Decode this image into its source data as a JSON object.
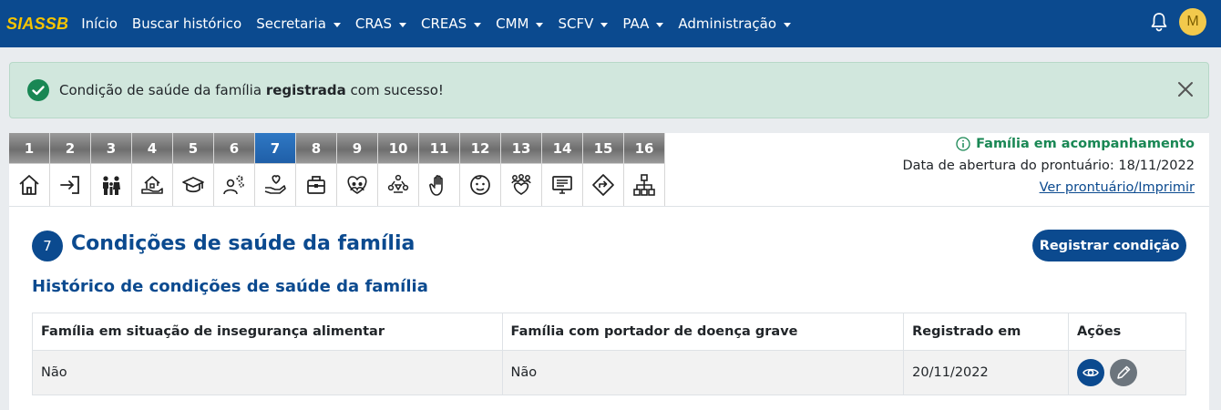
{
  "navbar": {
    "brand": "SIASSB",
    "items": [
      {
        "label": "Início",
        "dropdown": false
      },
      {
        "label": "Buscar histórico",
        "dropdown": false
      },
      {
        "label": "Secretaria",
        "dropdown": true
      },
      {
        "label": "CRAS",
        "dropdown": true
      },
      {
        "label": "CREAS",
        "dropdown": true
      },
      {
        "label": "CMM",
        "dropdown": true
      },
      {
        "label": "SCFV",
        "dropdown": true
      },
      {
        "label": "PAA",
        "dropdown": true
      },
      {
        "label": "Administração",
        "dropdown": true
      }
    ],
    "avatar_initial": "M"
  },
  "alert": {
    "text_before": "Condição de saúde da família ",
    "text_bold": "registrada",
    "text_after": " com sucesso!"
  },
  "steps": [
    {
      "num": "1",
      "icon": "home-icon"
    },
    {
      "num": "2",
      "icon": "login-icon"
    },
    {
      "num": "3",
      "icon": "family-icon"
    },
    {
      "num": "4",
      "icon": "house-hand-icon"
    },
    {
      "num": "5",
      "icon": "graduation-cap-icon"
    },
    {
      "num": "6",
      "icon": "person-gears-icon"
    },
    {
      "num": "7",
      "icon": "hand-heart-icon",
      "active": true
    },
    {
      "num": "8",
      "icon": "briefcase-icon"
    },
    {
      "num": "9",
      "icon": "people-heart-icon"
    },
    {
      "num": "10",
      "icon": "people-circle-icon"
    },
    {
      "num": "11",
      "icon": "hand-stop-icon"
    },
    {
      "num": "12",
      "icon": "face-icon"
    },
    {
      "num": "13",
      "icon": "group-heart-icon"
    },
    {
      "num": "14",
      "icon": "monitor-list-icon"
    },
    {
      "num": "15",
      "icon": "direction-sign-icon"
    },
    {
      "num": "16",
      "icon": "hierarchy-icon"
    }
  ],
  "info": {
    "status": "Família em acompanhamento",
    "opening_date": "Data de abertura do prontuário: 18/11/2022",
    "print_link": "Ver prontuário/Imprimir"
  },
  "main": {
    "step_number": "7",
    "title": "Condições de saúde da família",
    "register_button": "Registrar condição",
    "section_title": "Histórico de condições de saúde da família",
    "table": {
      "headers": [
        "Família em situação de insegurança alimentar",
        "Família com portador de doença grave",
        "Registrado em",
        "Ações"
      ],
      "rows": [
        [
          "Não",
          "Não",
          "20/11/2022"
        ]
      ]
    }
  },
  "colors": {
    "primary": "#0b4a8f",
    "brand": "#f6c400",
    "success": "#198754",
    "alert_bg": "#d1e7dd"
  }
}
